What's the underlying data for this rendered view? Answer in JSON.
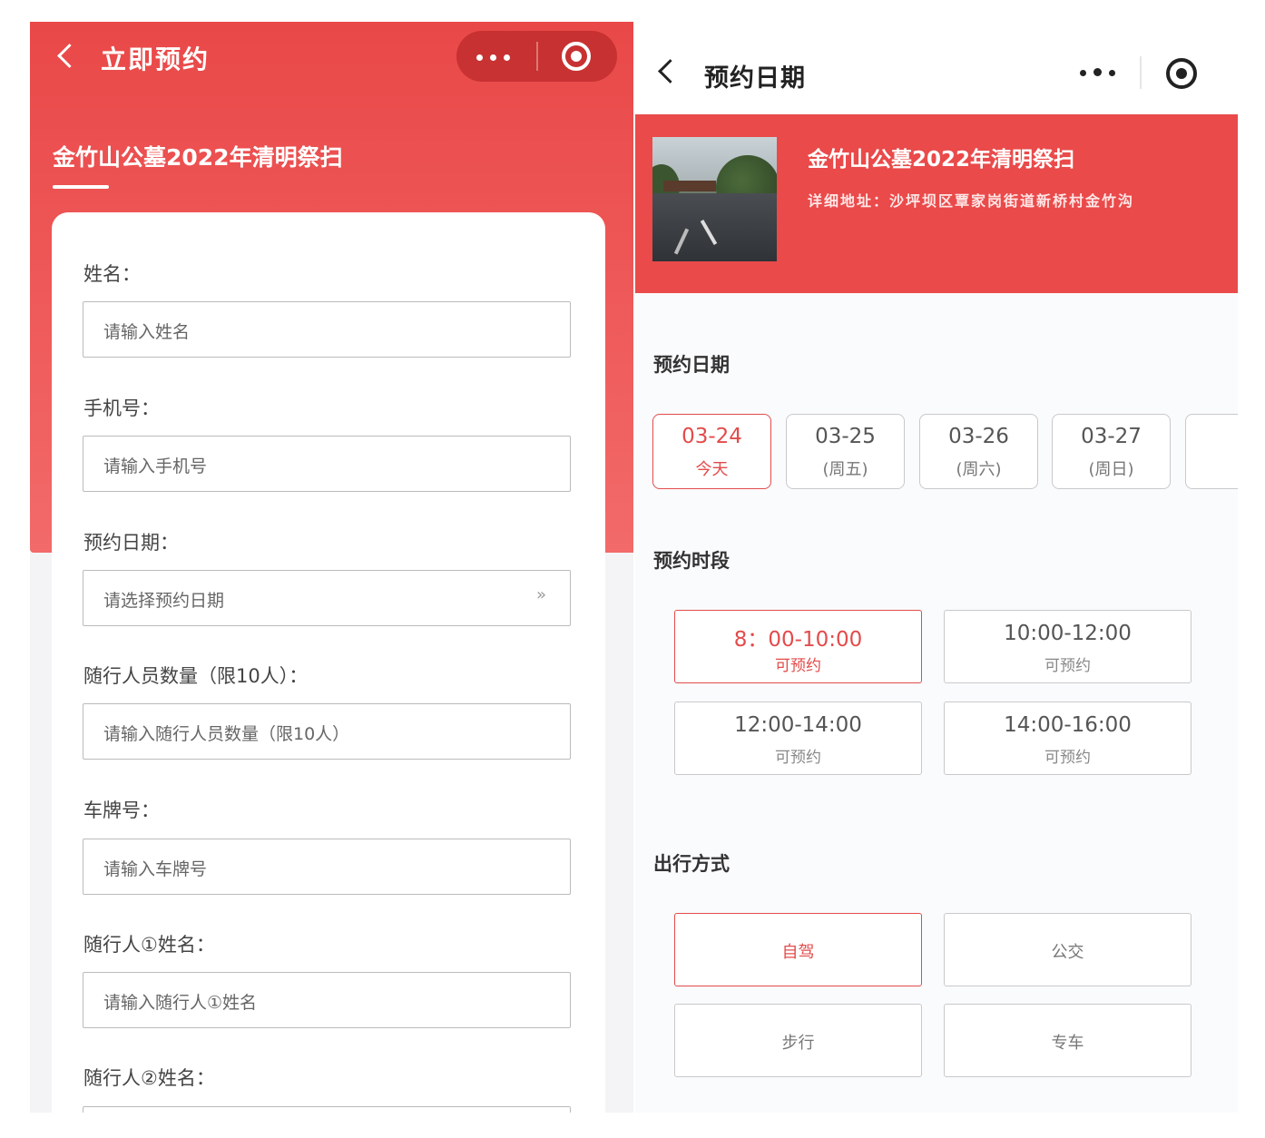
{
  "left": {
    "nav_title": "立即预约",
    "event_title": "金竹山公墓2022年清明祭扫",
    "fields": [
      {
        "label": "姓名：",
        "placeholder": "请输入姓名"
      },
      {
        "label": "手机号：",
        "placeholder": "请输入手机号"
      },
      {
        "label": "预约日期：",
        "placeholder": "请选择预约日期",
        "arrow": "»"
      },
      {
        "label": "随行人员数量（限10人）：",
        "placeholder": "请输入随行人员数量（限10人）"
      },
      {
        "label": "车牌号：",
        "placeholder": "请输入车牌号"
      },
      {
        "label": "随行人①姓名：",
        "placeholder": "请输入随行人①姓名"
      },
      {
        "label": "随行人②姓名：",
        "placeholder": ""
      }
    ]
  },
  "right": {
    "nav_title": "预约日期",
    "banner": {
      "title": "金竹山公墓2022年清明祭扫",
      "address": "详细地址：沙坪坝区覃家岗街道新桥村金竹沟"
    },
    "date_section_title": "预约日期",
    "dates": [
      {
        "date": "03-24",
        "weekday": "今天",
        "selected": true
      },
      {
        "date": "03-25",
        "weekday": "(周五)",
        "selected": false
      },
      {
        "date": "03-26",
        "weekday": "(周六)",
        "selected": false
      },
      {
        "date": "03-27",
        "weekday": "(周日)",
        "selected": false
      }
    ],
    "slot_section_title": "预约时段",
    "slots": [
      {
        "time": "8：00-10:00",
        "status": "可预约",
        "selected": true
      },
      {
        "time": "10:00-12:00",
        "status": "可预约",
        "selected": false
      },
      {
        "time": "12:00-14:00",
        "status": "可预约",
        "selected": false
      },
      {
        "time": "14:00-16:00",
        "status": "可预约",
        "selected": false
      }
    ],
    "mode_section_title": "出行方式",
    "modes": [
      {
        "label": "自驾",
        "selected": true
      },
      {
        "label": "公交",
        "selected": false
      },
      {
        "label": "步行",
        "selected": false
      },
      {
        "label": "专车",
        "selected": false
      }
    ]
  },
  "colors": {
    "accent": "#e34b4b",
    "hero_red": "#ea4a4a",
    "capsule_dark": "#a01414"
  },
  "icons": {
    "back": "back-chevron-icon",
    "more": "more-dots-icon",
    "close": "capsule-target-icon",
    "arrow": "double-chevron-right-icon"
  }
}
